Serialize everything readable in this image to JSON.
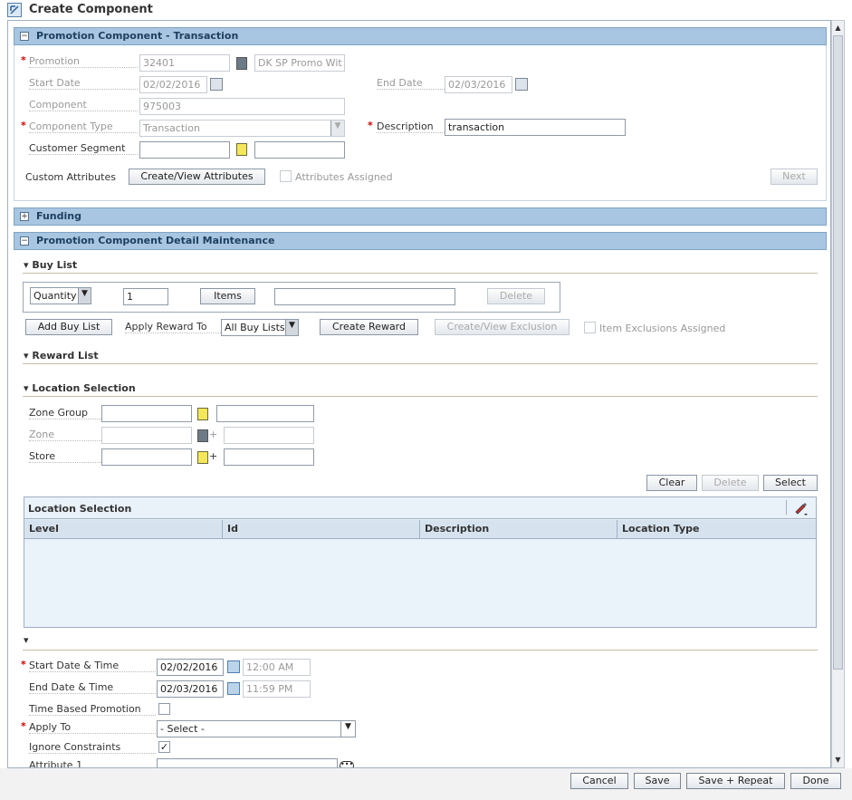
{
  "window": {
    "title": "Create Component"
  },
  "section1": {
    "title": "Promotion Component - Transaction",
    "promotion_label": "Promotion",
    "promotion_value": "32401",
    "promotion_name": "DK SP Promo Wit",
    "start_date_label": "Start Date",
    "start_date_value": "02/02/2016",
    "end_date_label": "End Date",
    "end_date_value": "02/03/2016",
    "component_label": "Component",
    "component_value": "975003",
    "component_type_label": "Component Type",
    "component_type_value": "Transaction",
    "description_label": "Description",
    "description_value": "transaction",
    "customer_segment_label": "Customer Segment",
    "custom_attributes_label": "Custom Attributes",
    "create_view_attributes": "Create/View Attributes",
    "attributes_assigned": "Attributes Assigned",
    "next": "Next"
  },
  "funding": {
    "title": "Funding"
  },
  "detail": {
    "title": "Promotion Component Detail Maintenance",
    "buy_list": {
      "heading": "Buy List",
      "type_value": "Quantity",
      "qty_value": "1",
      "items_btn": "Items",
      "delete_btn": "Delete",
      "add_buy_list": "Add Buy List",
      "apply_reward_to_label": "Apply Reward To",
      "apply_reward_value": "All Buy Lists",
      "create_reward": "Create Reward",
      "create_view_exclusion": "Create/View Exclusion",
      "item_exclusions_assigned": "Item Exclusions Assigned"
    },
    "reward_list": {
      "heading": "Reward List"
    },
    "location": {
      "heading": "Location Selection",
      "zone_group_label": "Zone Group",
      "zone_label": "Zone",
      "store_label": "Store",
      "plus": "+",
      "clear": "Clear",
      "delete": "Delete",
      "select": "Select",
      "table_title": "Location Selection",
      "columns": [
        "Level",
        "Id",
        "Description",
        "Location Type"
      ]
    },
    "schedule": {
      "start_label": "Start Date & Time",
      "start_date": "02/02/2016",
      "start_time": "12:00 AM",
      "end_label": "End Date & Time",
      "end_date": "02/03/2016",
      "end_time": "11:59 PM",
      "time_based_label": "Time Based Promotion",
      "apply_to_label": "Apply To",
      "apply_to_value": "- Select -",
      "ignore_constraints_label": "Ignore Constraints",
      "attribute1_label": "Attribute 1"
    }
  },
  "footer": {
    "cancel": "Cancel",
    "save": "Save",
    "save_repeat": "Save + Repeat",
    "done": "Done"
  }
}
